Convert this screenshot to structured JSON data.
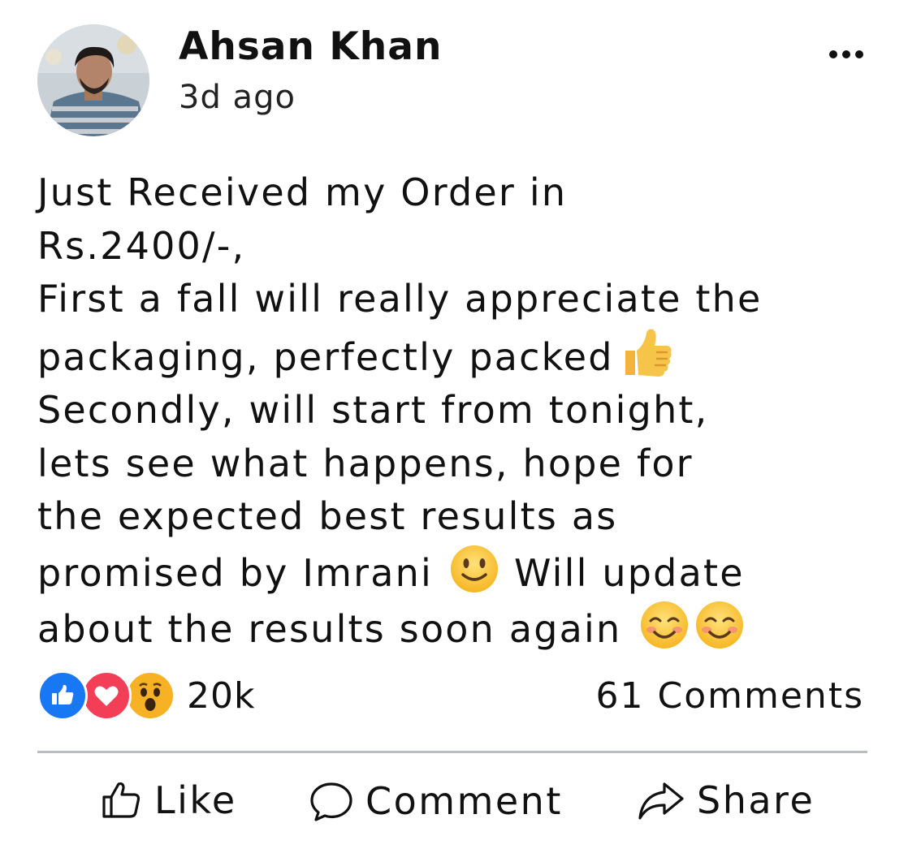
{
  "post": {
    "author": "Ahsan Khan",
    "timestamp": "3d ago",
    "body_lines": [
      "Just Received my Order in",
      "Rs.2400/-,",
      "First a fall will really appreciate the",
      "packaging, perfectly packed",
      "Secondly, will start from tonight,",
      "lets see what happens, hope for",
      "the expected best results as",
      "promised by Imrani",
      "about the results soon again"
    ],
    "inline_text": {
      "will_update": "Will update"
    },
    "emojis": [
      "thumbs-up-emoji",
      "slightly-smiling-face-emoji",
      "smiling-face-emoji",
      "smiling-face-emoji"
    ]
  },
  "reactions": {
    "icons": [
      "like-reaction-icon",
      "love-reaction-icon",
      "wow-reaction-icon"
    ],
    "count": "20k"
  },
  "comments": {
    "count_label": "61 Comments"
  },
  "actions": {
    "like": "Like",
    "comment": "Comment",
    "share": "Share"
  },
  "colors": {
    "like_blue": "#1877F2",
    "love_red": "#F33E58",
    "wow_yellow": "#F7B125",
    "text": "#111111",
    "divider": "#B9BCC1"
  }
}
